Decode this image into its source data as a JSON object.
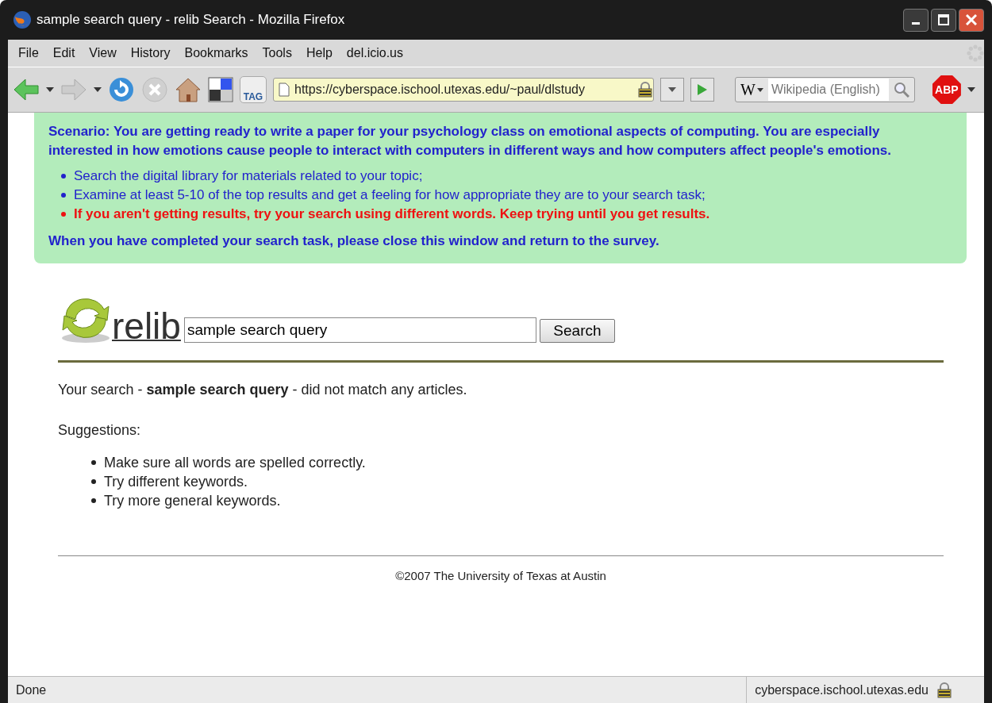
{
  "window": {
    "title": "sample search query - relib Search - Mozilla Firefox"
  },
  "menu": [
    "File",
    "Edit",
    "View",
    "History",
    "Bookmarks",
    "Tools",
    "Help",
    "del.icio.us"
  ],
  "toolbar": {
    "url": "https://cyberspace.ischool.utexas.edu/~paul/dlstudy",
    "search_placeholder": "Wikipedia (English)",
    "tag_label": "TAG",
    "engine_label": "W",
    "adblock_label": "ABP"
  },
  "scenario": {
    "intro": "Scenario: You are getting ready to write a paper for your psychology class on emotional aspects of computing. You are especially interested in how emotions cause people to interact with computers in different ways and how computers affect people's emotions.",
    "steps": [
      {
        "text": "Search the digital library for materials related to your topic;",
        "kind": "normal"
      },
      {
        "text": "Examine at least 5-10 of the top results and get a feeling for how appropriate they are to your search task;",
        "kind": "normal"
      },
      {
        "text": "If you aren't getting results, try your search using different words. Keep trying until you get results.",
        "kind": "warning"
      }
    ],
    "outro": "When you have completed your search task, please close this window and return to the survey."
  },
  "site": {
    "logo": "relib",
    "query": "sample search query",
    "search_button": "Search"
  },
  "result": {
    "message": "Your search - **sample search query** - did not match any articles.",
    "suggestions_label": "Suggestions:",
    "suggestions": [
      "Make sure all words are spelled correctly.",
      "Try different keywords.",
      "Try more general keywords."
    ]
  },
  "footer": "©2007 The University of Texas at Austin",
  "status_bar": {
    "status": "Done",
    "host": "cyberspace.ischool.utexas.edu"
  }
}
